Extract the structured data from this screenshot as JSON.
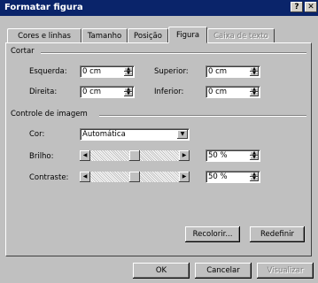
{
  "window": {
    "title": "Formatar figura",
    "help_button": "?",
    "close_button": "✕"
  },
  "tabs": [
    {
      "label": "Cores e linhas"
    },
    {
      "label": "Tamanho"
    },
    {
      "label": "Posição"
    },
    {
      "label": "Figura",
      "active": true
    },
    {
      "label": "Caixa de texto",
      "disabled": true
    }
  ],
  "crop": {
    "section_label": "Cortar",
    "left": {
      "label": "Esquerda:",
      "value": "0 cm"
    },
    "right": {
      "label": "Direita:",
      "value": "0 cm"
    },
    "top": {
      "label": "Superior:",
      "value": "0 cm"
    },
    "bottom": {
      "label": "Inferior:",
      "value": "0 cm"
    }
  },
  "image_control": {
    "section_label": "Controle de imagem",
    "color": {
      "label": "Cor:",
      "value": "Automática"
    },
    "brightness": {
      "label": "Brilho:",
      "value": "50 %",
      "level": 0.5
    },
    "contrast": {
      "label": "Contraste:",
      "value": "50 %",
      "level": 0.5
    }
  },
  "panel_buttons": {
    "recolor": "Recolorir...",
    "reset": "Redefinir"
  },
  "dialog_buttons": {
    "ok": "OK",
    "cancel": "Cancelar",
    "preview": "Visualizar"
  }
}
